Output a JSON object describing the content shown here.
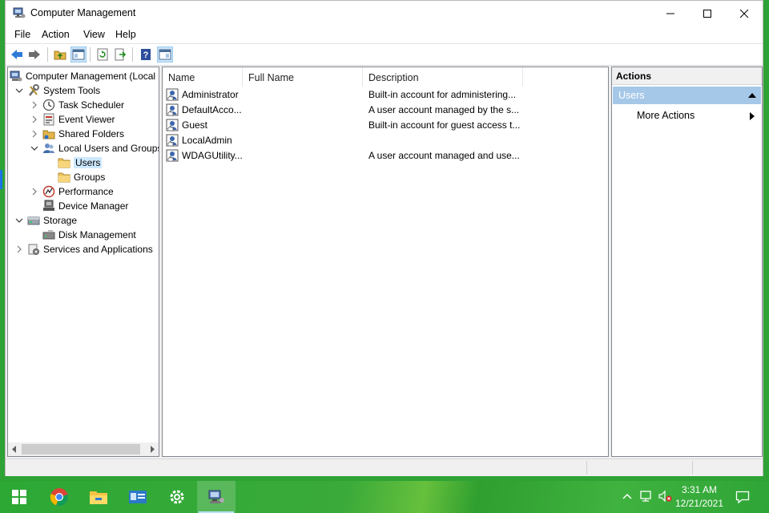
{
  "window": {
    "title": "Computer Management"
  },
  "menu": [
    "File",
    "Action",
    "View",
    "Help"
  ],
  "tree": [
    {
      "label": "Computer Management (Local",
      "icon": "computer-management-icon",
      "level": 0,
      "arrow": "none"
    },
    {
      "label": "System Tools",
      "icon": "system-tools-icon",
      "level": 1,
      "arrow": "expanded"
    },
    {
      "label": "Task Scheduler",
      "icon": "clock-icon",
      "level": 2,
      "arrow": "collapsed"
    },
    {
      "label": "Event Viewer",
      "icon": "event-viewer-icon",
      "level": 2,
      "arrow": "collapsed"
    },
    {
      "label": "Shared Folders",
      "icon": "shared-folder-icon",
      "level": 2,
      "arrow": "collapsed"
    },
    {
      "label": "Local Users and Groups",
      "icon": "users-group-icon",
      "level": 2,
      "arrow": "expanded"
    },
    {
      "label": "Users",
      "icon": "folder-icon",
      "level": 3,
      "arrow": "none",
      "selected": true
    },
    {
      "label": "Groups",
      "icon": "folder-icon",
      "level": 3,
      "arrow": "none"
    },
    {
      "label": "Performance",
      "icon": "performance-icon",
      "level": 2,
      "arrow": "collapsed"
    },
    {
      "label": "Device Manager",
      "icon": "device-manager-icon",
      "level": 2,
      "arrow": "none"
    },
    {
      "label": "Storage",
      "icon": "storage-icon",
      "level": 1,
      "arrow": "expanded"
    },
    {
      "label": "Disk Management",
      "icon": "disk-icon",
      "level": 2,
      "arrow": "none"
    },
    {
      "label": "Services and Applications",
      "icon": "services-icon",
      "level": 1,
      "arrow": "collapsed"
    }
  ],
  "list": {
    "columns": [
      "Name",
      "Full Name",
      "Description"
    ],
    "rows": [
      {
        "name": "Administrator",
        "full_name": "",
        "description": "Built-in account for administering..."
      },
      {
        "name": "DefaultAcco...",
        "full_name": "",
        "description": "A user account managed by the s..."
      },
      {
        "name": "Guest",
        "full_name": "",
        "description": "Built-in account for guest access t..."
      },
      {
        "name": "LocalAdmin",
        "full_name": "",
        "description": ""
      },
      {
        "name": "WDAGUtility...",
        "full_name": "",
        "description": "A user account managed and use..."
      }
    ]
  },
  "actions": {
    "header": "Actions",
    "section": "Users",
    "item": "More Actions"
  },
  "taskbar": {
    "time": "3:31 AM",
    "date": "12/21/2021"
  },
  "colors": {
    "accent": "#a6c8e8",
    "taskbar": "#2fa236"
  }
}
